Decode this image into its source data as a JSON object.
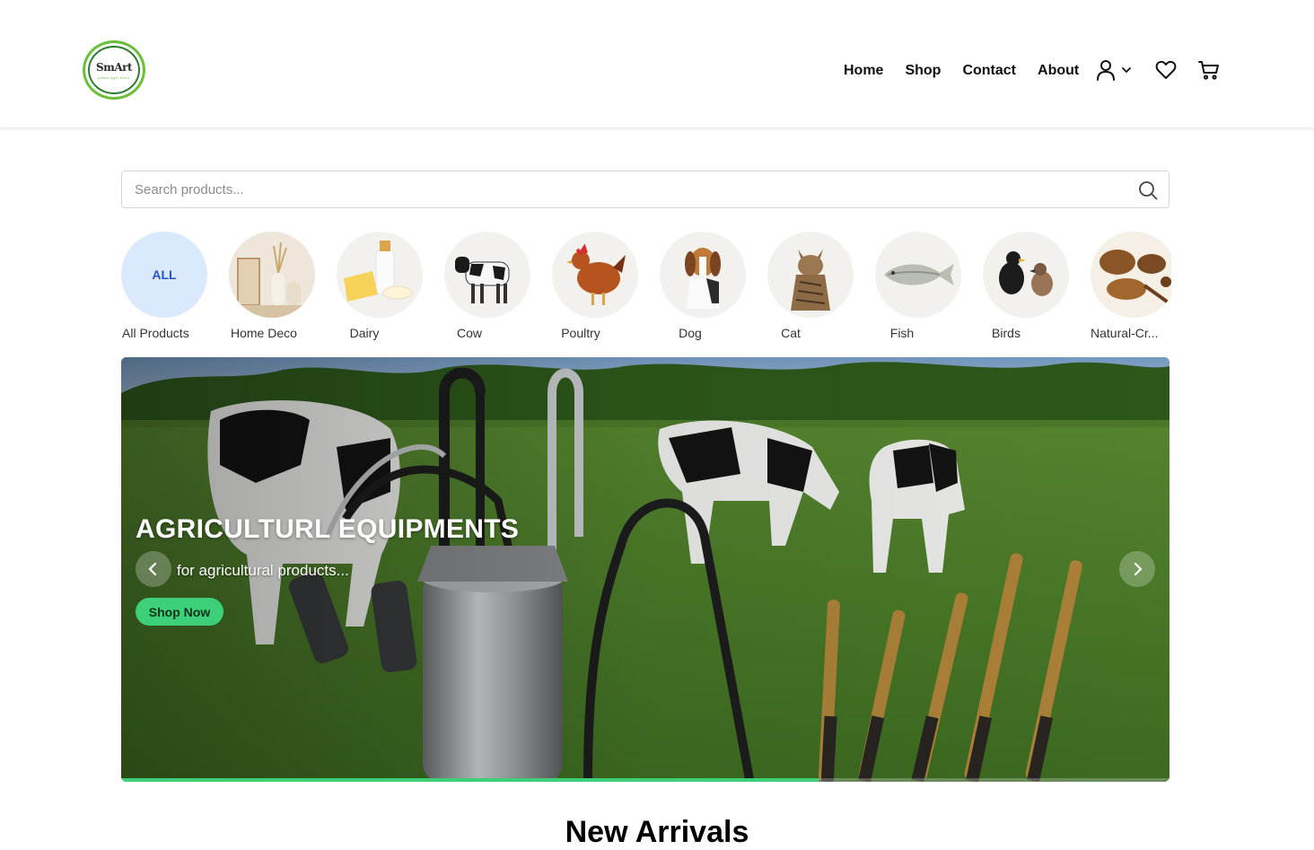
{
  "brand": {
    "logo_text": "SmArt",
    "logo_subtitle": "smart agri store"
  },
  "nav": {
    "links": [
      {
        "label": "Home"
      },
      {
        "label": "Shop"
      },
      {
        "label": "Contact"
      },
      {
        "label": "About"
      }
    ],
    "icons": [
      "user-icon",
      "chevron-down-icon",
      "heart-icon",
      "cart-icon"
    ]
  },
  "search": {
    "placeholder": "Search products...",
    "value": ""
  },
  "categories": [
    {
      "label": "All Products",
      "badge": "ALL"
    },
    {
      "label": "Home Deco"
    },
    {
      "label": "Dairy"
    },
    {
      "label": "Cow"
    },
    {
      "label": "Poultry"
    },
    {
      "label": "Dog"
    },
    {
      "label": "Cat"
    },
    {
      "label": "Fish"
    },
    {
      "label": "Birds"
    },
    {
      "label": "Natural-Cr..."
    }
  ],
  "hero": {
    "title": "AGRICULTURL EQUIPMENTS",
    "subtitle": "for agricultural products...",
    "button": "Shop Now",
    "progress": 0.665
  },
  "sections": {
    "new_arrivals": "New Arrivals"
  },
  "colors": {
    "accent": "#3ed079",
    "all_badge_bg": "#dbe9fe",
    "all_badge_text": "#2255c4",
    "logo_ring": "#6cbf3a"
  }
}
